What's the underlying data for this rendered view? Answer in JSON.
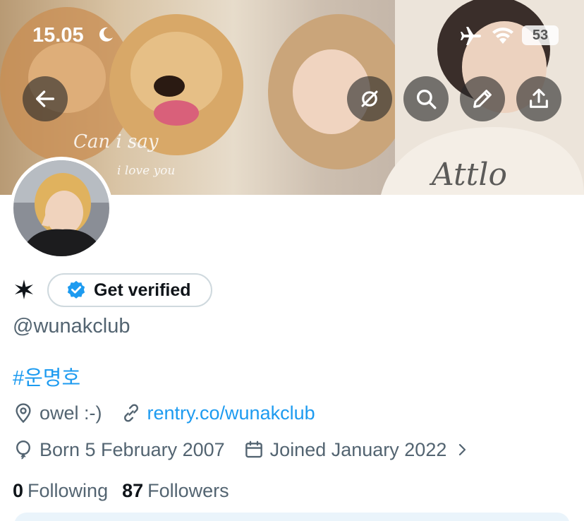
{
  "status_bar": {
    "time": "15.05",
    "battery": "53"
  },
  "banner": {
    "caption_line1": "Can i say",
    "caption_line2": "i love you"
  },
  "profile": {
    "handle": "@wunakclub",
    "verify_label": "Get verified",
    "bio": "#운명호",
    "location": "owel :-)",
    "website": "rentry.co/wunakclub",
    "birthday": "Born 5 February 2007",
    "joined": "Joined January 2022",
    "following_count": "0",
    "following_label": "Following",
    "followers_count": "87",
    "followers_label": "Followers"
  },
  "colors": {
    "accent": "#1d9bf0",
    "muted": "#536471",
    "text": "#0f1419"
  },
  "icons": [
    "moon-icon",
    "airplane-icon",
    "wifi-icon",
    "back-arrow-icon",
    "grok-icon",
    "search-icon",
    "pencil-icon",
    "share-icon",
    "star-icon",
    "verified-badge-icon",
    "location-icon",
    "link-icon",
    "balloon-icon",
    "calendar-icon",
    "chevron-right-icon"
  ]
}
